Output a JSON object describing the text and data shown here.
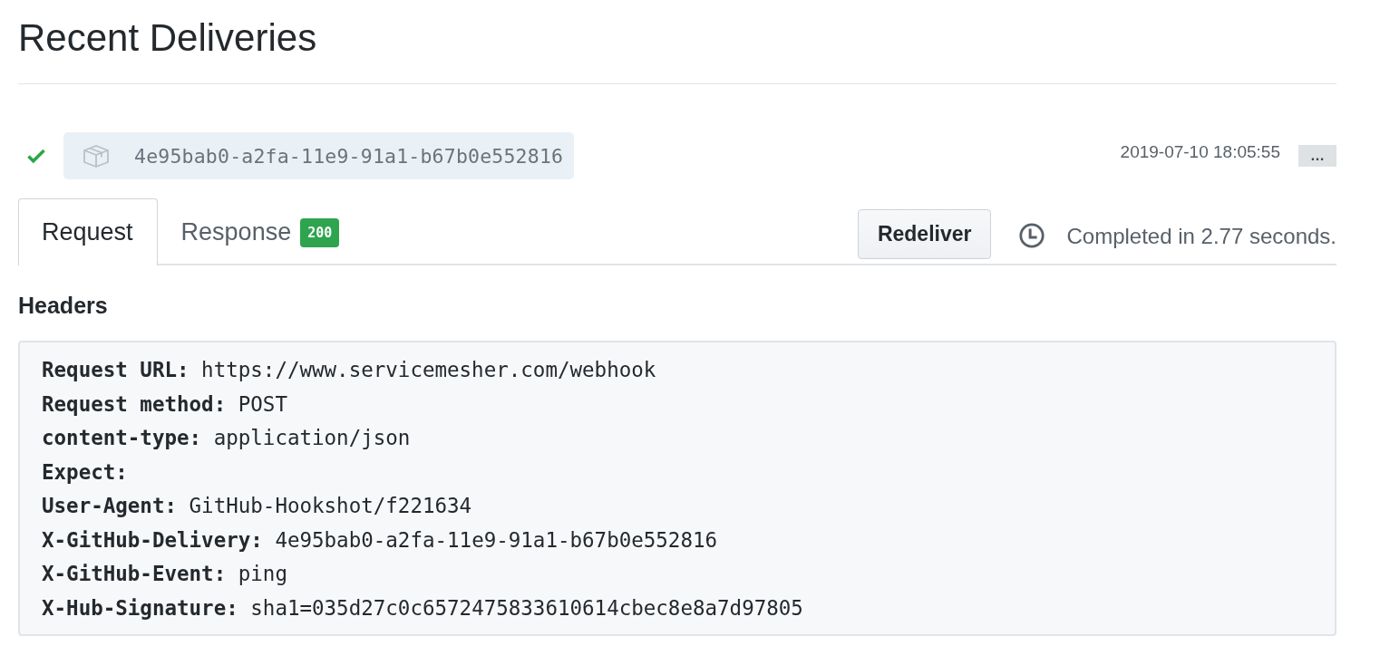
{
  "title": "Recent Deliveries",
  "delivery": {
    "delivered": true,
    "guid": "4e95bab0-a2fa-11e9-91a1-b67b0e552816",
    "timestamp": "2019-07-10 18:05:55",
    "menu": "…"
  },
  "tabs": [
    {
      "label": "Request",
      "selected": true
    },
    {
      "label": "Response",
      "selected": false,
      "badge": "200"
    }
  ],
  "redeliver_button": "Redeliver",
  "duration": "Completed in 2.77 seconds.",
  "headers_title": "Headers",
  "headers": [
    "**Request URL:** https://www.servicemesher.com/webhook",
    "**Request method:** POST",
    "**content-type:** application/json",
    "**Expect:**",
    "**User-Agent:** GitHub-Hookshot/f221634",
    "**X-GitHub-Delivery:** 4e95bab0-a2fa-11e9-91a1-b67b0e552816",
    "**X-GitHub-Event:** ping",
    "**X-Hub-Signature:** sha1=035d27c0c6572475833610614cbec8e8a7d97805"
  ]
}
